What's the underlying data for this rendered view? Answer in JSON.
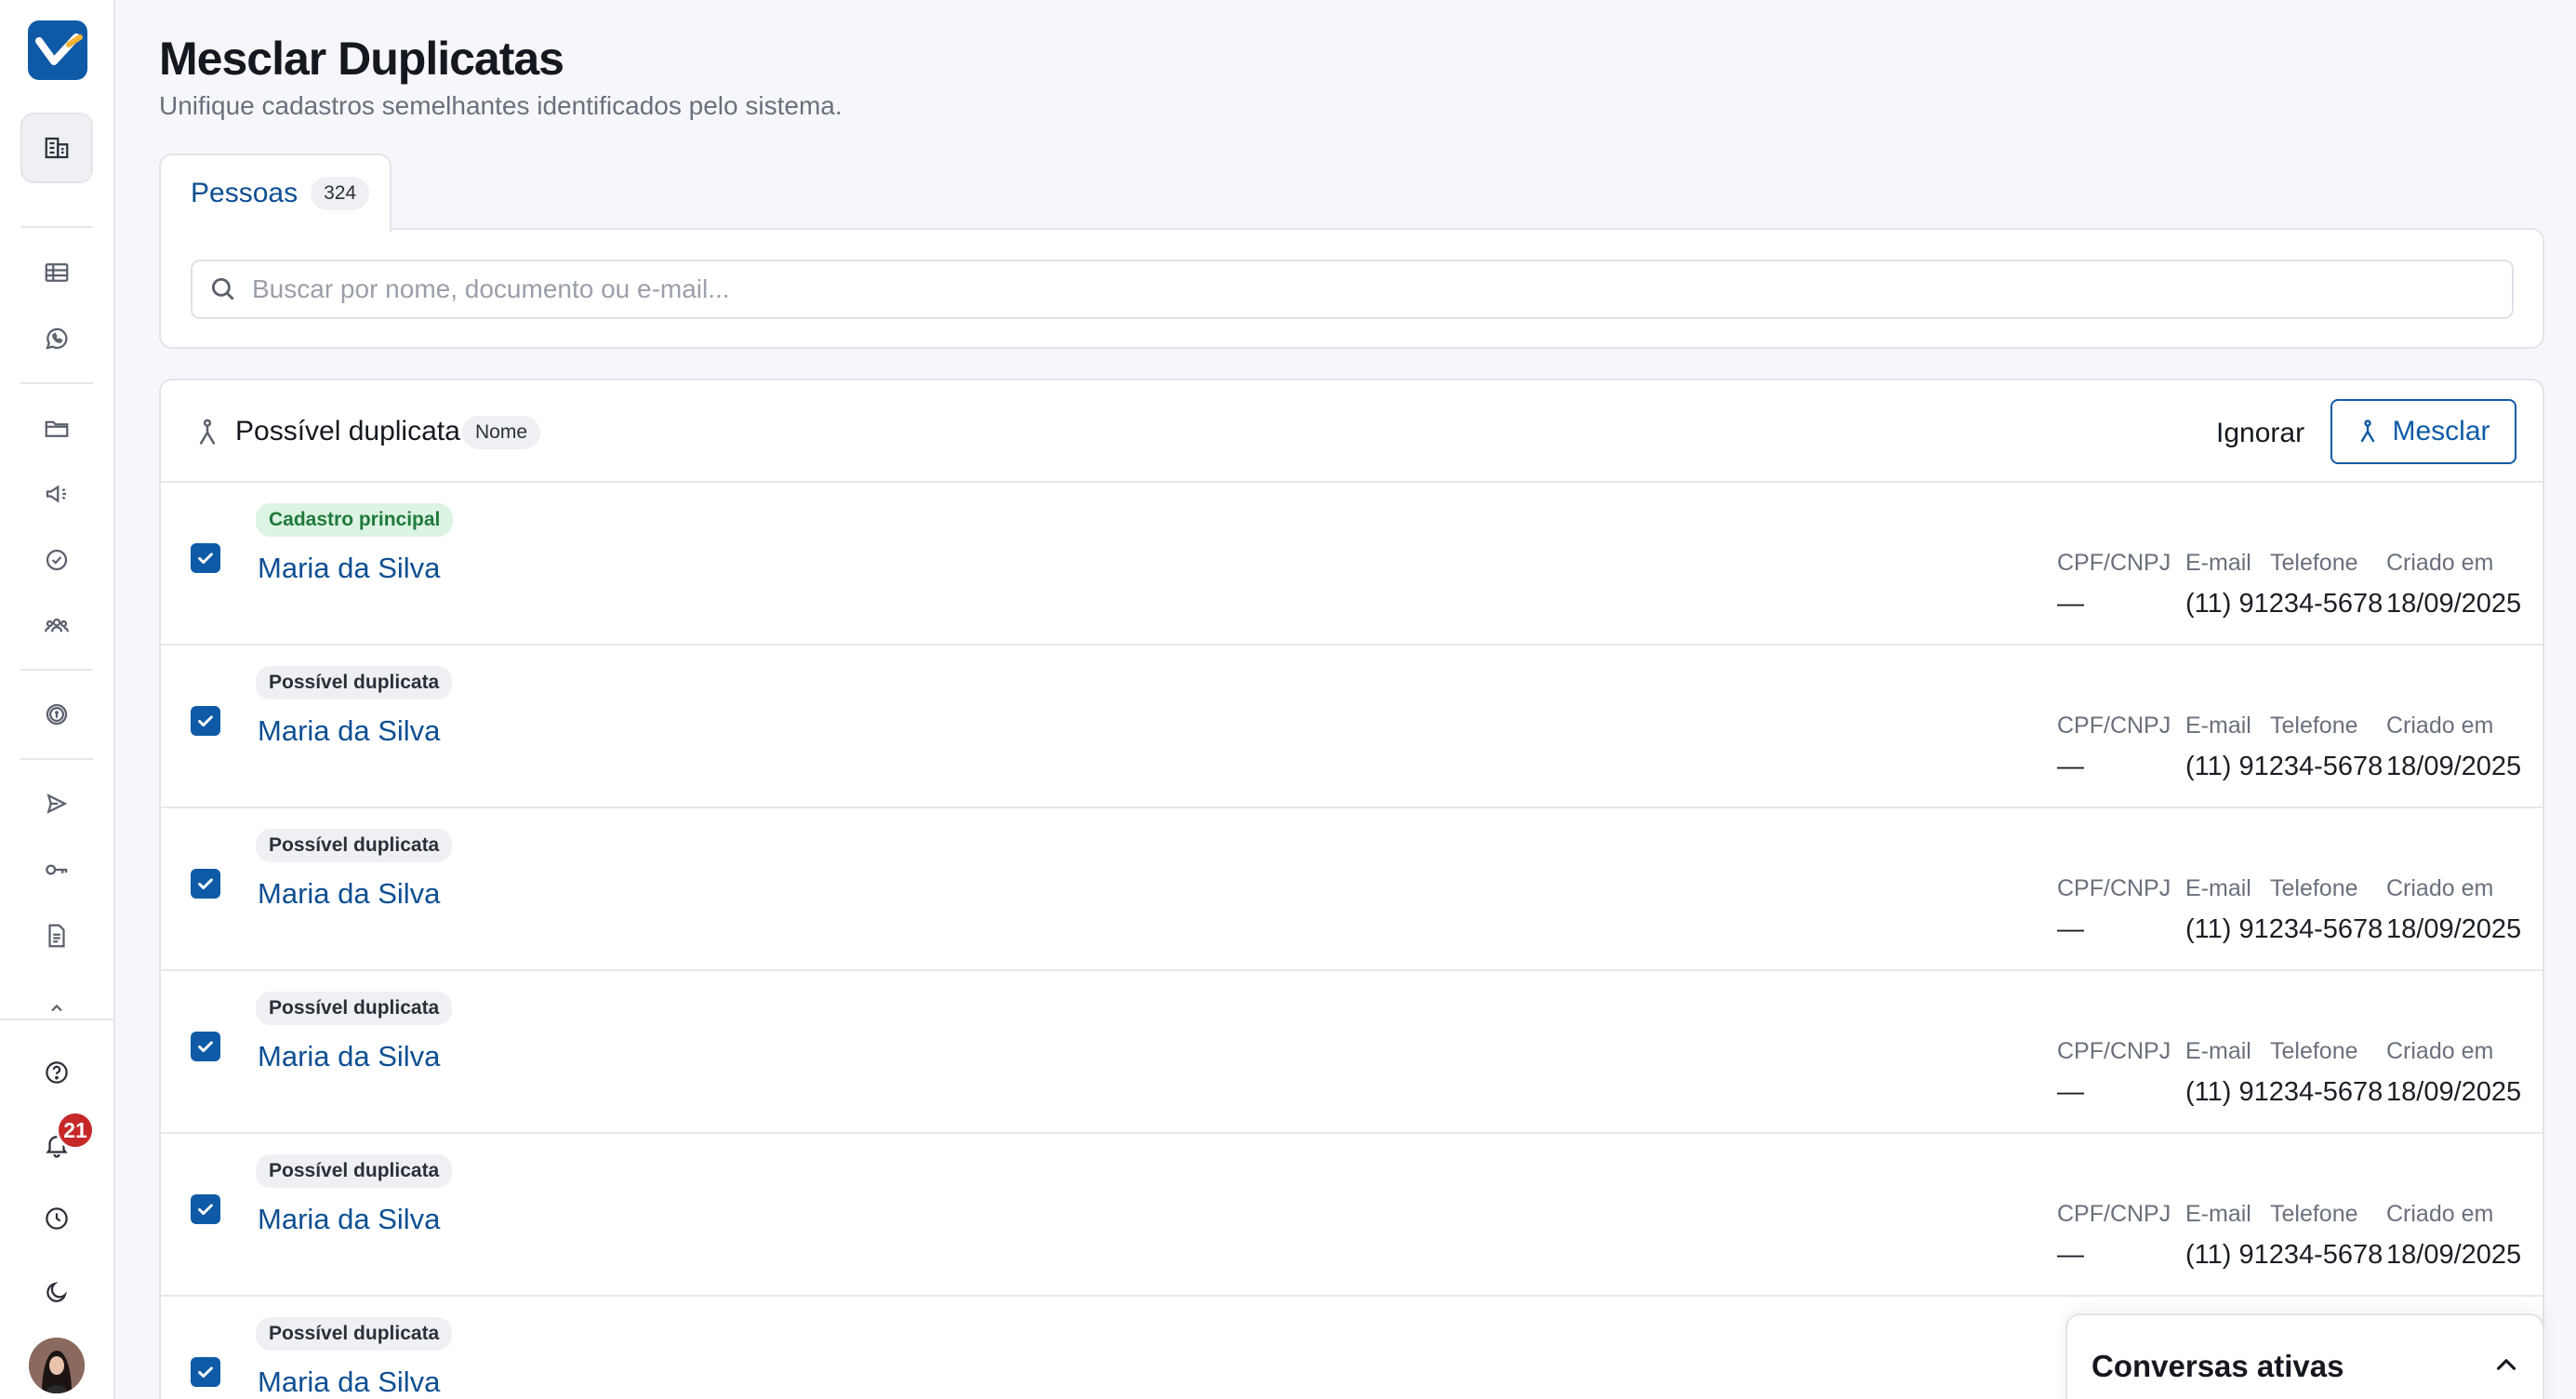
{
  "header": {
    "title": "Mesclar Duplicatas",
    "subtitle": "Unifique cadastros semelhantes identificados pelo sistema."
  },
  "tabs": [
    {
      "label": "Pessoas",
      "count": "324"
    }
  ],
  "search": {
    "placeholder": "Buscar por nome, documento ou e-mail...",
    "value": ""
  },
  "group": {
    "title": "Possível duplicata",
    "match_field": "Nome",
    "ignore_label": "Ignorar",
    "merge_label": "Mesclar"
  },
  "columns": {
    "document": "CPF/CNPJ",
    "email": "E-mail",
    "phone": "Telefone",
    "created": "Criado em"
  },
  "records": [
    {
      "badge": "Cadastro principal",
      "name": "Maria da Silva",
      "document": "—",
      "phone": "(11) 91234-5678",
      "created": "18/09/2025",
      "checked": true
    },
    {
      "badge": "Possível duplicata",
      "name": "Maria da Silva",
      "document": "—",
      "phone": "(11) 91234-5678",
      "created": "18/09/2025",
      "checked": true
    },
    {
      "badge": "Possível duplicata",
      "name": "Maria da Silva",
      "document": "—",
      "phone": "(11) 91234-5678",
      "created": "18/09/2025",
      "checked": true
    },
    {
      "badge": "Possível duplicata",
      "name": "Maria da Silva",
      "document": "—",
      "phone": "(11) 91234-5678",
      "created": "18/09/2025",
      "checked": true
    },
    {
      "badge": "Possível duplicata",
      "name": "Maria da Silva",
      "document": "—",
      "phone": "(11) 91234-5678",
      "created": "18/09/2025",
      "checked": true
    },
    {
      "badge": "Possível duplicata",
      "name": "Maria da Silva",
      "checked": true
    }
  ],
  "sidebar": {
    "notifications_count": "21",
    "icons": [
      "building-icon",
      "table-icon",
      "whatsapp-icon",
      "folder-icon",
      "megaphone-icon",
      "check-circle-icon",
      "users-icon",
      "coin-icon",
      "send-icon",
      "key-icon",
      "document-icon",
      "chevron-up-icon",
      "help-icon",
      "bell-icon",
      "clock-icon",
      "moon-icon"
    ]
  },
  "chat_panel": {
    "title": "Conversas ativas"
  },
  "colors": {
    "brand": "#0e5aa6",
    "link": "#0e4f93",
    "success_bg": "#dcf4e3",
    "success_text": "#1f7a3b",
    "danger": "#c62828"
  }
}
